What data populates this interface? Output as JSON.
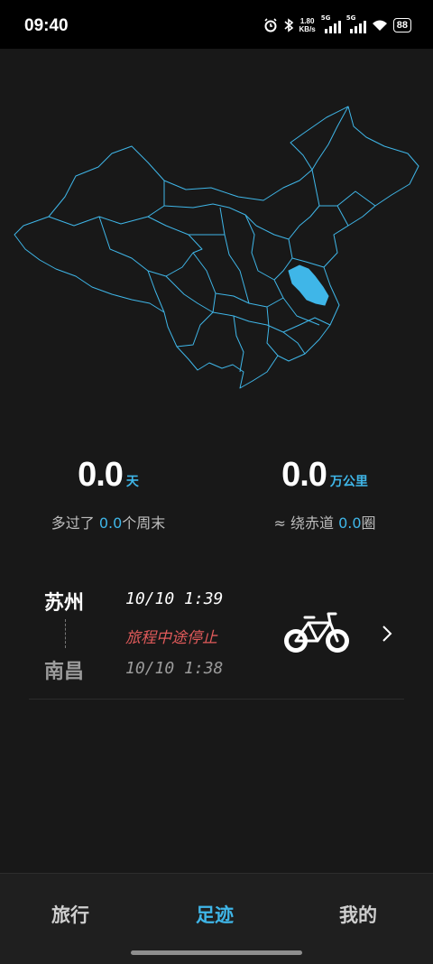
{
  "status_bar": {
    "time": "09:40",
    "net_speed_value": "1.80",
    "net_speed_unit": "KB/s",
    "sim1": "5G",
    "sim2": "5G",
    "battery": "88"
  },
  "map": {
    "outline_color": "#3fb6e8",
    "highlight_color": "#3fb6e8",
    "highlight_province": "江苏"
  },
  "stats": {
    "days": {
      "value": "0.0",
      "unit": "天",
      "sub_prefix": "多过了",
      "sub_value": "0.0",
      "sub_suffix": "个周末"
    },
    "distance": {
      "value": "0.0",
      "unit": "万公里",
      "sub_prefix": "≈ 绕赤道",
      "sub_value": "0.0",
      "sub_suffix": "圈"
    }
  },
  "trip": {
    "from_city": "苏州",
    "to_city": "南昌",
    "end_time": "10/10 1:39",
    "start_time": "10/10 1:38",
    "status": "旅程中途停止",
    "vehicle_icon": "bicycle-icon"
  },
  "nav": {
    "tabs": [
      {
        "label": "旅行"
      },
      {
        "label": "足迹"
      },
      {
        "label": "我的"
      }
    ],
    "active": "足迹"
  },
  "colors": {
    "accent": "#3fb6e8",
    "warning": "#e05a5a",
    "background": "#181818"
  }
}
